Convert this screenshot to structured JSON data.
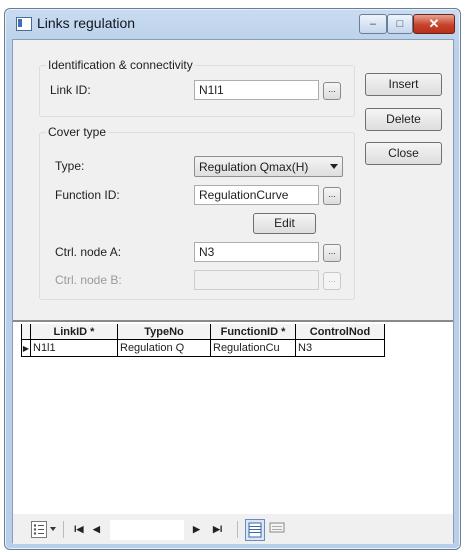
{
  "window": {
    "title": "Links regulation",
    "minimize_glyph": "–",
    "maximize_glyph": "□",
    "close_glyph": "✕"
  },
  "identification": {
    "legend": "Identification & connectivity",
    "link_id_label": "Link ID:",
    "link_id_value": "N1l1",
    "browse": "..."
  },
  "cover_type": {
    "legend": "Cover type",
    "type_label": "Type:",
    "type_value": "Regulation Qmax(H)",
    "function_id_label": "Function ID:",
    "function_id_value": "RegulationCurve",
    "browse": "...",
    "edit_label": "Edit",
    "ctrl_a_label": "Ctrl. node A:",
    "ctrl_a_value": "N3",
    "ctrl_b_label": "Ctrl. node B:",
    "ctrl_b_value": ""
  },
  "actions": {
    "insert": "Insert",
    "delete": "Delete",
    "close": "Close"
  },
  "grid": {
    "columns": [
      "LinkID *",
      "TypeNo",
      "FunctionID *",
      "ControlNod"
    ],
    "rows": [
      {
        "indicator": "▶",
        "cells": [
          "N1l1",
          "Regulation Q",
          "RegulationCu",
          "N3"
        ]
      }
    ]
  },
  "navigator": {
    "first": "I◀",
    "prev": "◀",
    "next": "▶",
    "last": "▶I"
  }
}
